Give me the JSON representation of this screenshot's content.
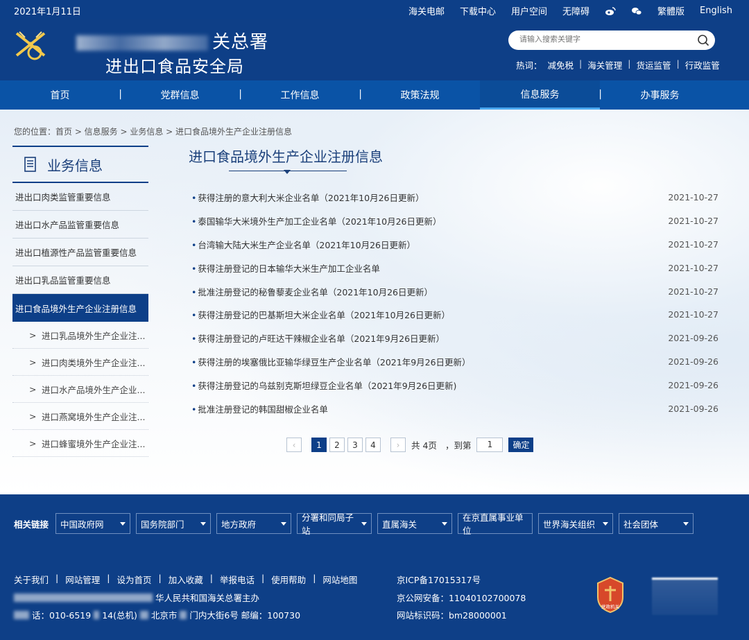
{
  "topbar": {
    "date": "2021年1月11日",
    "links": [
      "海关电邮",
      "下载中心",
      "用户空间",
      "无障碍",
      "繁體版",
      "English"
    ],
    "icons": [
      "weibo-icon",
      "wechat-icon"
    ]
  },
  "header": {
    "title_line1_visible": "关总署",
    "title_line2": "进出口食品安全局",
    "search_placeholder": "请输入搜索关键字",
    "hot_label": "热词：",
    "hot_words": [
      "减免税",
      "海关管理",
      "货运监管",
      "行政监管"
    ]
  },
  "nav": {
    "items": [
      "首页",
      "党群信息",
      "工作信息",
      "政策法规",
      "信息服务",
      "办事服务"
    ],
    "active_index": 4
  },
  "breadcrumb": "您的位置：首页 > 信息服务 > 业务信息 > 进口食品境外生产企业注册信息",
  "sidebar": {
    "title": "业务信息",
    "menu": [
      "进出口肉类监管重要信息",
      "进出口水产品监管重要信息",
      "进出口植源性产品监管重要信息",
      "进出口乳品监管重要信息",
      "进口食品境外生产企业注册信息"
    ],
    "active_index": 4,
    "sub": [
      "进口乳品境外生产企业注...",
      "进口肉类境外生产企业注...",
      "进口水产品境外生产企业...",
      "进口燕窝境外生产企业注...",
      "进口蜂蜜境外生产企业注..."
    ]
  },
  "main": {
    "title": "进口食品境外生产企业注册信息",
    "rows": [
      {
        "text": "获得注册的意大利大米企业名单（2021年10月26日更新）",
        "date": "2021-10-27"
      },
      {
        "text": "泰国输华大米境外生产加工企业名单（2021年10月26日更新）",
        "date": "2021-10-27"
      },
      {
        "text": "台湾输大陆大米生产企业名单（2021年10月26日更新）",
        "date": "2021-10-27"
      },
      {
        "text": "获得注册登记的日本输华大米生产加工企业名单",
        "date": "2021-10-27"
      },
      {
        "text": "批准注册登记的秘鲁藜麦企业名单（2021年10月26日更新）",
        "date": "2021-10-27"
      },
      {
        "text": "获得注册登记的巴基斯坦大米企业名单（2021年10月26日更新）",
        "date": "2021-10-27"
      },
      {
        "text": "获得注册登记的卢旺达干辣椒企业名单（2021年9月26日更新）",
        "date": "2021-09-26"
      },
      {
        "text": "获得注册的埃塞俄比亚输华绿豆生产企业名单（2021年9月26日更新）",
        "date": "2021-09-26"
      },
      {
        "text": "获得注册登记的乌兹别克斯坦绿豆企业名单（2021年9月26日更新)",
        "date": "2021-09-26"
      },
      {
        "text": "批准注册登记的韩国甜椒企业名单",
        "date": "2021-09-26"
      }
    ]
  },
  "pager": {
    "prev": "‹",
    "pages": [
      "1",
      "2",
      "3",
      "4"
    ],
    "current": "1",
    "next": "›",
    "total": "共 4页",
    "goto_label": "，到第",
    "goto_value": "1",
    "ok": "确定"
  },
  "footer": {
    "related_label": "相关链接",
    "related": [
      "中国政府网",
      "国务院部门",
      "地方政府",
      "分署和同局子站",
      "直属海关",
      "在京直属事业单位",
      "世界海关组织",
      "社会团体"
    ],
    "links": [
      "关于我们",
      "网站管理",
      "设为首页",
      "加入收藏",
      "举报电话",
      "使用帮助",
      "网站地图"
    ],
    "line2_visible": "华人民共和国海关总署主办",
    "line3_a": "话：010-6519",
    "line3_b": "14(总机)",
    "line3_c": "北京市",
    "line3_d": "门内大街6号 邮编：100730",
    "icp": "京ICP备17015317号",
    "police": "京公网安备：11040102700078",
    "site_code": "网站标识码：bm28000001",
    "badge_text": "党政机关"
  }
}
